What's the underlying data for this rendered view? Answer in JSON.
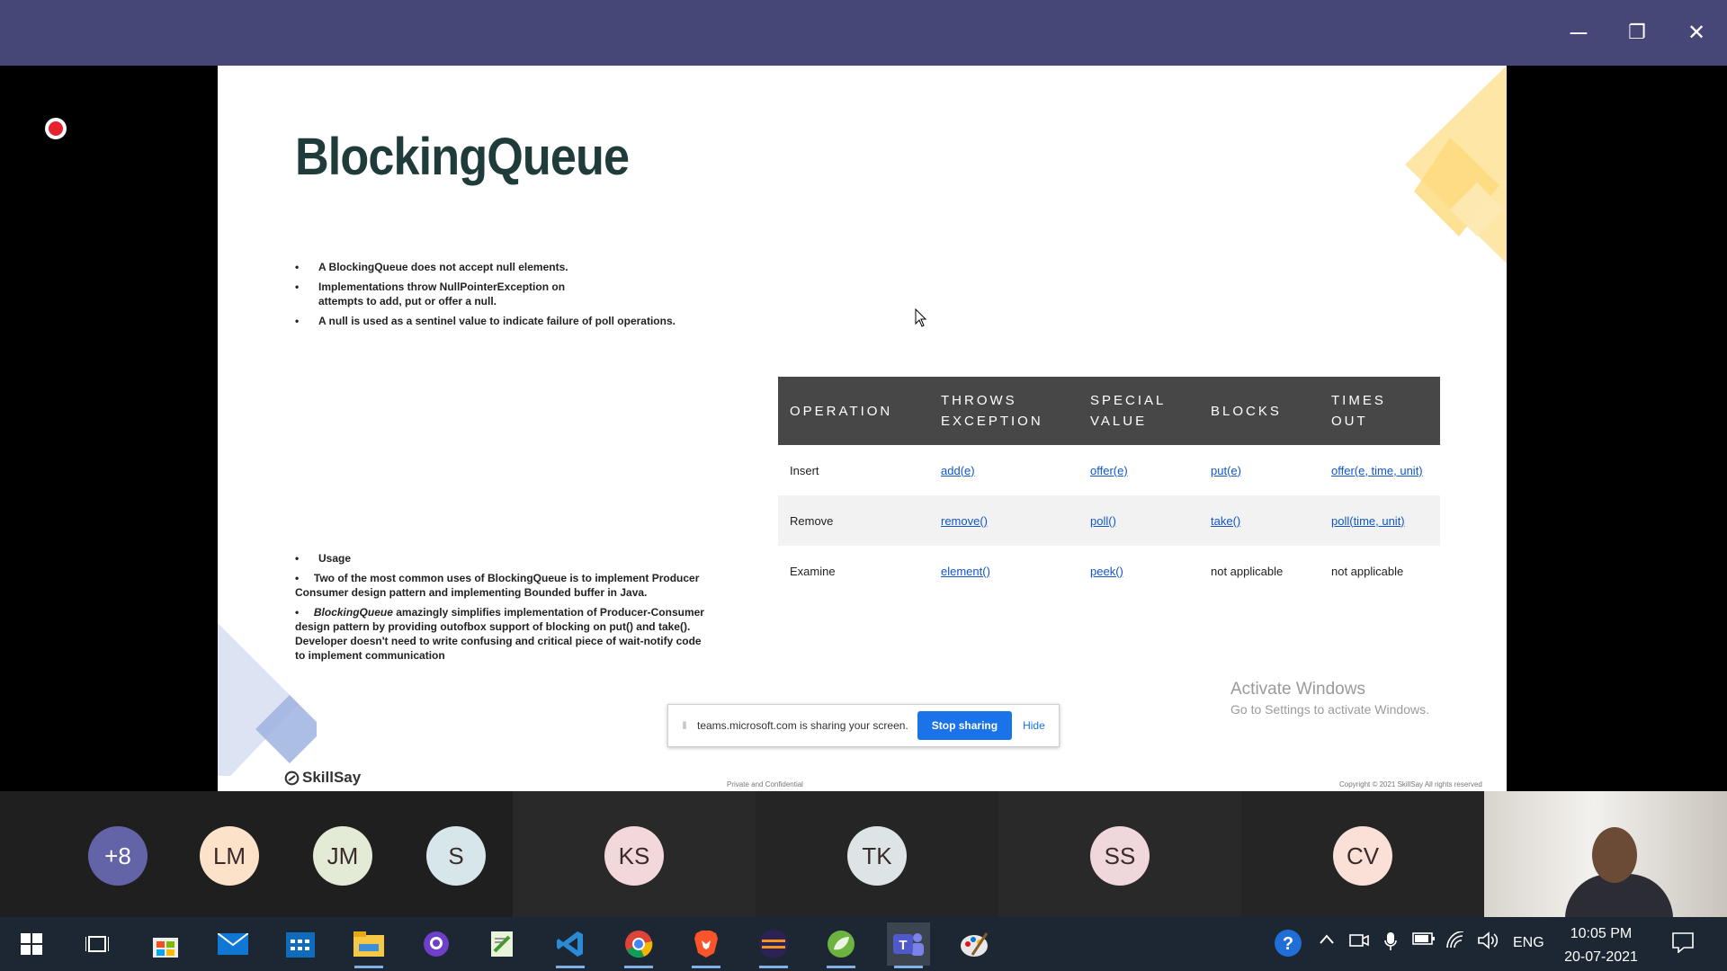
{
  "window": {
    "minimize": "─",
    "maximize": "❐",
    "close": "✕"
  },
  "slide": {
    "title": "BlockingQueue",
    "bullets": [
      "A BlockingQueue does not accept null elements.",
      "Implementations throw NullPointerException on attempts to add, put or offer a null.",
      "A null is used as a sentinel value to indicate failure of poll operations."
    ],
    "usage": {
      "heading": "Usage",
      "item1": "Two of the most common uses of BlockingQueue is to implement Producer Consumer design pattern and implementing Bounded buffer in Java.",
      "item2_em": "BlockingQueue",
      "item2_rest": " amazingly simplifies implementation of Producer-Consumer design pattern by providing outofbox support of blocking on put() and take(). Developer doesn't need to write confusing and critical piece of wait-notify code to implement communication"
    },
    "table": {
      "headers": [
        "OPERATION",
        "THROWS EXCEPTION",
        "SPECIAL VALUE",
        "BLOCKS",
        "TIMES OUT"
      ],
      "rows": [
        [
          "Insert",
          "add(e)",
          "offer(e)",
          "put(e)",
          "offer(e, time, unit)"
        ],
        [
          "Remove",
          "remove()",
          "poll()",
          "take()",
          "poll(time, unit)"
        ],
        [
          "Examine",
          "element()",
          "peek()",
          "not applicable",
          "not applicable"
        ]
      ]
    },
    "logo": "SkillSay",
    "footer_mid": "Private and Confidential",
    "footer_right": "Copyright © 2021 SkillSay All rights reserved"
  },
  "watermark": {
    "line1": "Activate Windows",
    "line2": "Go to Settings to activate Windows."
  },
  "sharebar": {
    "text": "teams.microsoft.com is sharing your screen.",
    "stop": "Stop sharing",
    "hide": "Hide"
  },
  "participants": [
    {
      "initials": "+8",
      "color": "#6264a7",
      "text_color": "#ffffff"
    },
    {
      "initials": "LM",
      "color": "#fbe2c8"
    },
    {
      "initials": "JM",
      "color": "#e3ead5"
    },
    {
      "initials": "S",
      "color": "#d7e6ea"
    },
    {
      "initials": "KS",
      "color": "#f2d8da"
    },
    {
      "initials": "TK",
      "color": "#dde4e6"
    },
    {
      "initials": "SS",
      "color": "#f0d7dc"
    },
    {
      "initials": "CV",
      "color": "#fbe0d8"
    }
  ],
  "taskbar": {
    "apps": [
      "start-icon",
      "task-view-icon",
      "store-icon",
      "mail-icon",
      "calendar-icon",
      "file-explorer-icon",
      "github-icon",
      "notepad-icon",
      "vscode-icon",
      "chrome-icon",
      "brave-icon",
      "eclipse-icon",
      "spring-icon",
      "teams-icon",
      "paint-icon"
    ],
    "lang": "ENG",
    "time": "10:05 PM",
    "date": "20-07-2021"
  }
}
